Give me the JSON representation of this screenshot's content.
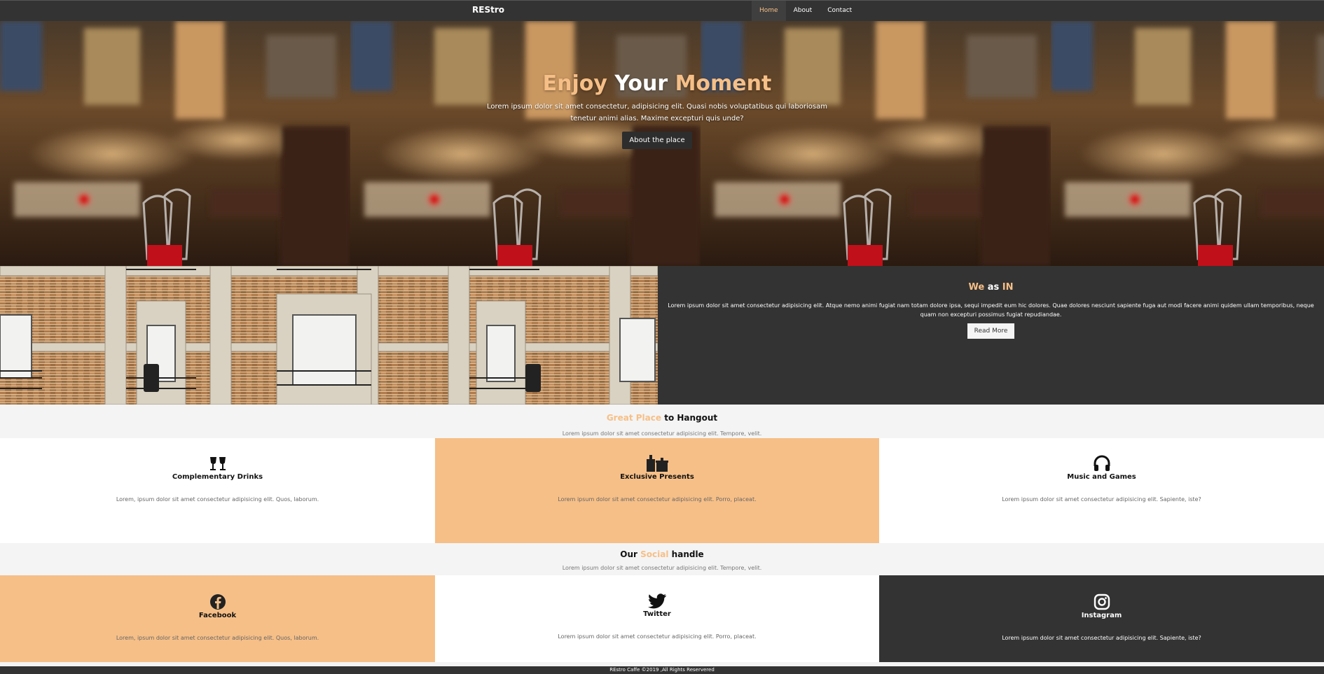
{
  "nav": {
    "brand": "REStro",
    "links": [
      {
        "label": "Home",
        "active": true
      },
      {
        "label": "About",
        "active": false
      },
      {
        "label": "Contact",
        "active": false
      }
    ]
  },
  "hero": {
    "title_part1": "Enjoy",
    "title_part2": "Your",
    "title_part3": "Moment",
    "text": "Lorem ipsum dolor sit amet consectetur, adipisicing elit. Quasi nobis voluptatibus qui laboriosam tenetur animi alias. Maxime excepturi quis unde?",
    "button": "About the place"
  },
  "about": {
    "title_part1": "We",
    "title_part2": "as",
    "title_part3": "IN",
    "text": "Lorem ipsum dolor sit amet consectetur adipisicing elit. Atque nemo animi fugiat nam totam dolore ipsa, sequi impedit eum hic dolores. Quae dolores nesciunt sapiente fuga aut modi facere animi quidem ullam temporibus, neque quam non excepturi possimus fugiat repudiandae.",
    "button": "Read More"
  },
  "hangout": {
    "title_accent": "Great Place",
    "title_rest": "to Hangout",
    "subtitle": "Lorem ipsum dolor sit amet consectetur adipisicing elit. Tempore, velit.",
    "cards": [
      {
        "icon": "glasses-cheers-icon",
        "title": "Complementary Drinks",
        "text": "Lorem, ipsum dolor sit amet consectetur adipisicing elit. Quos, laborum."
      },
      {
        "icon": "gifts-icon",
        "title": "Exclusive Presents",
        "text": "Lorem ipsum dolor sit amet consectetur adipisicing elit. Porro, placeat."
      },
      {
        "icon": "headphones-icon",
        "title": "Music and Games",
        "text": "Lorem ipsum dolor sit amet consectetur adipisicing elit. Sapiente, iste?"
      }
    ]
  },
  "social": {
    "title_start": "Our",
    "title_accent": "Social",
    "title_end": "handle",
    "subtitle": "Lorem ipsum dolor sit amet consectetur adipisicing elit. Tempore, velit.",
    "cards": [
      {
        "icon": "facebook-icon",
        "title": "Facebook",
        "text": "Lorem, ipsum dolor sit amet consectetur adipisicing elit. Quos, laborum."
      },
      {
        "icon": "twitter-icon",
        "title": "Twitter",
        "text": "Lorem ipsum dolor sit amet consectetur adipisicing elit. Porro, placeat."
      },
      {
        "icon": "instagram-icon",
        "title": "Instagram",
        "text": "Lorem ipsum dolor sit amet consectetur adipisicing elit. Sapiente, iste?"
      }
    ]
  },
  "footer": {
    "text": "REstro Caffe ©2019 ,All Rights Reservered"
  },
  "colors": {
    "accent": "#f6bf87",
    "dark": "#333333",
    "light": "#f4f4f4"
  }
}
